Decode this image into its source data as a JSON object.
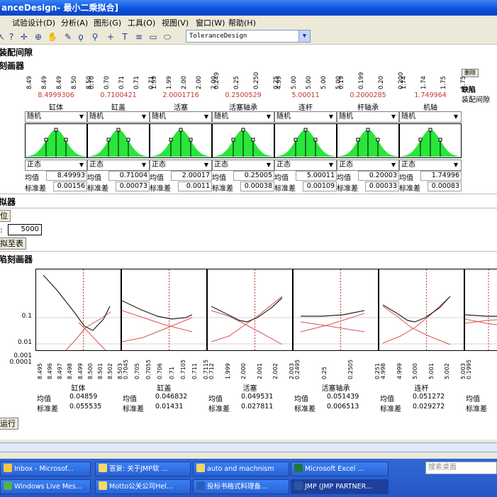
{
  "window": {
    "title": "anceDesign- 最小二乘拟合]"
  },
  "menu": [
    "试验设计(D)",
    "分析(A)",
    "图形(G)",
    "工具(O)",
    "视图(V)",
    "窗口(W)",
    "帮助(H)"
  ],
  "toolbar": {
    "icons": [
      "help-icon",
      "crosshair-icon",
      "target-icon",
      "hand-icon",
      "brush-icon",
      "lasso-icon",
      "zoom-icon",
      "plus-icon",
      "text-icon",
      "line-icon",
      "rect-icon",
      "ellipse-icon"
    ],
    "design_select": "ToleranceDesign"
  },
  "sections": {
    "assembly": "装配间隙",
    "profiler": "刻画器",
    "simulator": "拟器",
    "defect_profiler": "陷刻画器"
  },
  "right_panel": {
    "button": "删除",
    "defect_label": "缺陷",
    "assembly_label": "装配间隙"
  },
  "factors": [
    {
      "name": "缸体",
      "current": "8.4999306",
      "ticks": [
        "8.49",
        "8.49",
        "8.49",
        "8.50",
        "8.50"
      ],
      "dist": "随机",
      "type": "正态",
      "mean": "8.49993",
      "sd": "0.00156"
    },
    {
      "name": "缸盖",
      "current": "0.7100421",
      "ticks": [
        "0.70",
        "0.70",
        "0.71",
        "0.71",
        "0.71"
      ],
      "dist": "随机",
      "type": "正态",
      "mean": "0.71004",
      "sd": "0.00073"
    },
    {
      "name": "活塞",
      "current": "2.0001716",
      "ticks": [
        "1.99",
        "1.99",
        "2.00",
        "2.00",
        "2.00"
      ],
      "dist": "随机",
      "type": "正态",
      "mean": "2.00017",
      "sd": "0.0011"
    },
    {
      "name": "活塞轴承",
      "current": "0.2500529",
      "ticks": [
        "0.249",
        "0.25",
        "0.250",
        "0.25"
      ],
      "dist": "随机",
      "type": "正态",
      "mean": "0.25005",
      "sd": "0.00038"
    },
    {
      "name": "连杆",
      "current": "5.00011",
      "ticks": [
        "4.99",
        "5.00",
        "5.00",
        "5.00",
        "5.00"
      ],
      "dist": "随机",
      "type": "正态",
      "mean": "5.00011",
      "sd": "0.00109"
    },
    {
      "name": "杆轴承",
      "current": "0.2000285",
      "ticks": [
        "0.19",
        "0.199",
        "0.20",
        "0.200"
      ],
      "dist": "随机",
      "type": "正态",
      "mean": "0.20003",
      "sd": "0.00033"
    },
    {
      "name": "机轴",
      "current": "1.749964",
      "ticks": [
        "1.74",
        "1.74",
        "1.75",
        "1.75"
      ],
      "dist": "随机",
      "type": "正态",
      "mean": "1.74996",
      "sd": "0.00083"
    }
  ],
  "stat_labels": {
    "mean": "均值",
    "sd": "标准差"
  },
  "simulator": {
    "position_label": "位",
    "n_label": ":",
    "n_value": "5000",
    "to_table": "拟至表"
  },
  "defect": {
    "y_ticks": [
      "0.1",
      "0.01",
      "0.001",
      "0.0001"
    ],
    "plots": [
      {
        "name": "缸体",
        "mean": "0.04859",
        "sd": "0.055535",
        "xticks": [
          "8.495",
          "8.496",
          "8.497",
          "8.498",
          "8.499",
          "8.500",
          "8.501",
          "8.502",
          "8.503"
        ]
      },
      {
        "name": "缸盖",
        "mean": "0.046832",
        "sd": "0.01431",
        "xticks": [
          "0.7045",
          "0.705",
          "0.7055",
          "0.706",
          "0.71",
          "0.7105",
          "0.711",
          "0.7115"
        ]
      },
      {
        "name": "活塞",
        "mean": "0.049531",
        "sd": "0.027811",
        "xticks": [
          "0.712",
          "1.999",
          "2.000",
          "2.001",
          "2.002",
          "2.003"
        ]
      },
      {
        "name": "活塞轴承",
        "mean": "0.051439",
        "sd": "0.006513",
        "xticks": [
          "0.2495",
          "0.25",
          "0.2505",
          "0.251"
        ]
      },
      {
        "name": "连杆",
        "mean": "0.051272",
        "sd": "0.029272",
        "xticks": [
          "4.998",
          "4.999",
          "5.000",
          "5.001",
          "5.002",
          "5.003"
        ]
      },
      {
        "name": "",
        "mean": "",
        "sd": "",
        "xticks": [
          "0.1995"
        ]
      }
    ],
    "mean_label": "均值",
    "sd_label": "标准差",
    "partial_mean": "均值",
    "partial_sd": "标准差"
  },
  "run_button": "运行",
  "taskbar": {
    "tasks": [
      {
        "label": "Inbox - Microsof...",
        "color": "#f5c542"
      },
      {
        "label": "答复: 关于JMP软 ...",
        "color": "#f8d868"
      },
      {
        "label": "auto and machnism",
        "color": "#f3d36b"
      },
      {
        "label": "Microsoft Excel ...",
        "color": "#1f7a3a"
      },
      {
        "label": "Windows Live Mes...",
        "color": "#4fb04f"
      },
      {
        "label": "Motto公关公司Hel...",
        "color": "#f8d868"
      },
      {
        "label": "投标书格式料理备...",
        "color": "#2a5fb8"
      },
      {
        "label": "JMP (JMP PARTNER...",
        "color": "#2a57a0"
      }
    ],
    "search": "搜索桌面"
  }
}
